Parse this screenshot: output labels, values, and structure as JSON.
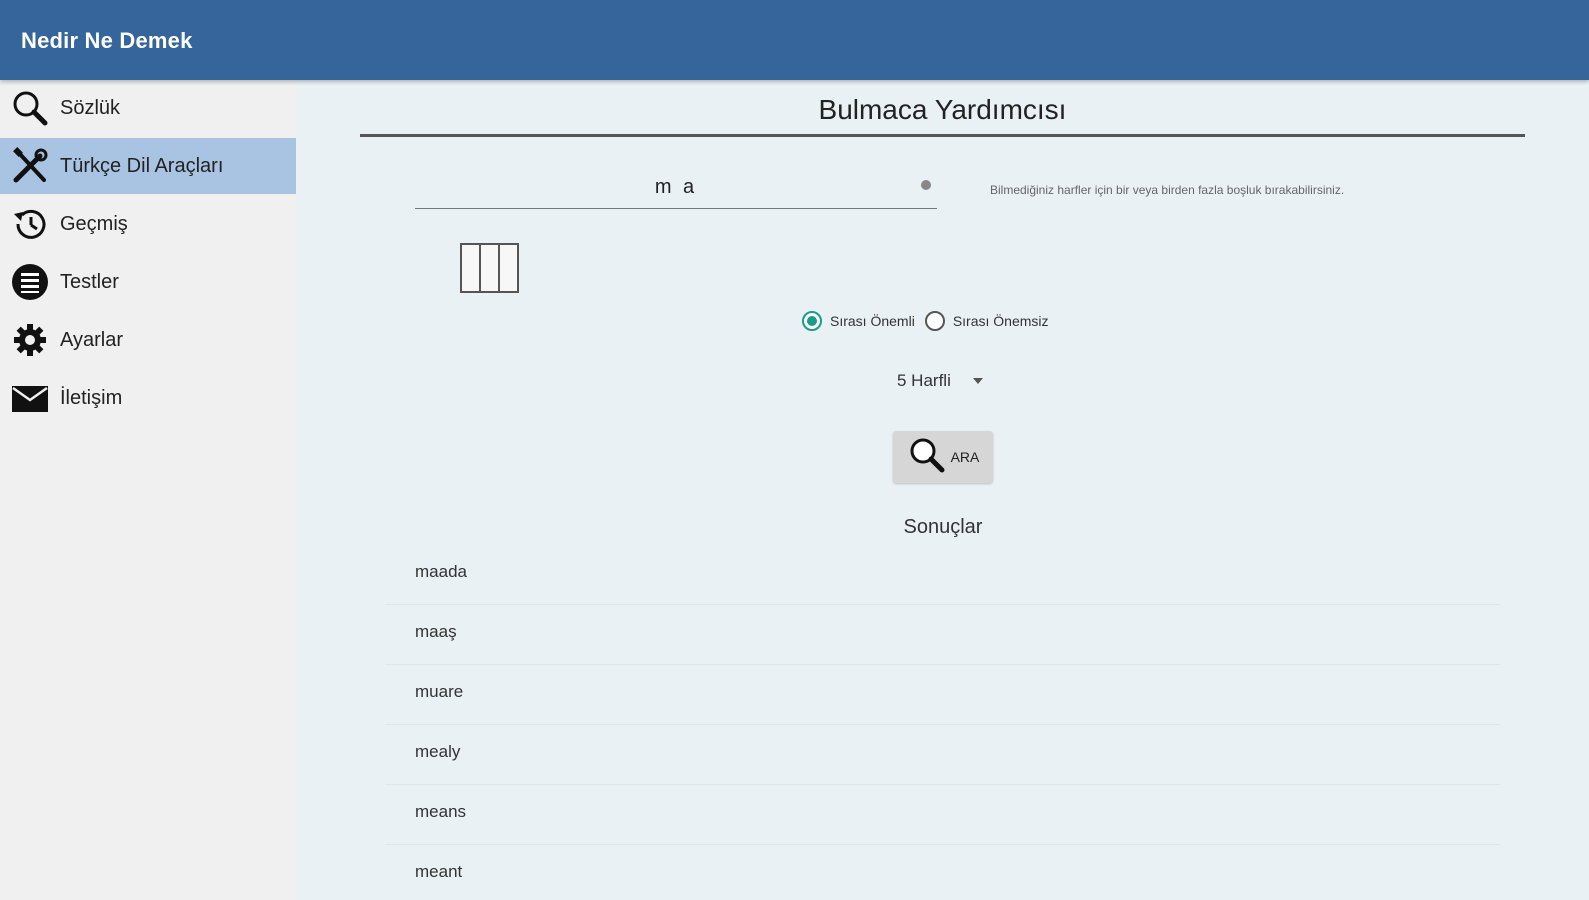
{
  "app": {
    "title": "Nedir Ne Demek"
  },
  "sidebar": {
    "items": [
      {
        "label": "Sözlük",
        "icon": "search-icon",
        "active": false
      },
      {
        "label": "Türkçe Dil Araçları",
        "icon": "tools-icon",
        "active": true
      },
      {
        "label": "Geçmiş",
        "icon": "history-icon",
        "active": false
      },
      {
        "label": "Testler",
        "icon": "list-icon",
        "active": false
      },
      {
        "label": "Ayarlar",
        "icon": "gear-icon",
        "active": false
      },
      {
        "label": "İletişim",
        "icon": "mail-icon",
        "active": false
      }
    ]
  },
  "main": {
    "title": "Bulmaca Yardımcısı",
    "letters_value": "m a",
    "hint": "Bilmediğiniz harfler için bir veya birden fazla boşluk bırakabilirsiniz.",
    "order_options": [
      {
        "label": "Sırası Önemli",
        "checked": true
      },
      {
        "label": "Sırası Önemsiz",
        "checked": false
      }
    ],
    "length_select": "5 Harfli",
    "search_button": "ARA",
    "results_title": "Sonuçlar",
    "results": [
      "maada",
      "maaş",
      "muare",
      "mealy",
      "means",
      "meant"
    ]
  },
  "colors": {
    "appbar": "#35659a",
    "sidebar_active": "#a9c4e2",
    "radio_accent": "#1a9c8a",
    "background": "#eaf1f4"
  }
}
